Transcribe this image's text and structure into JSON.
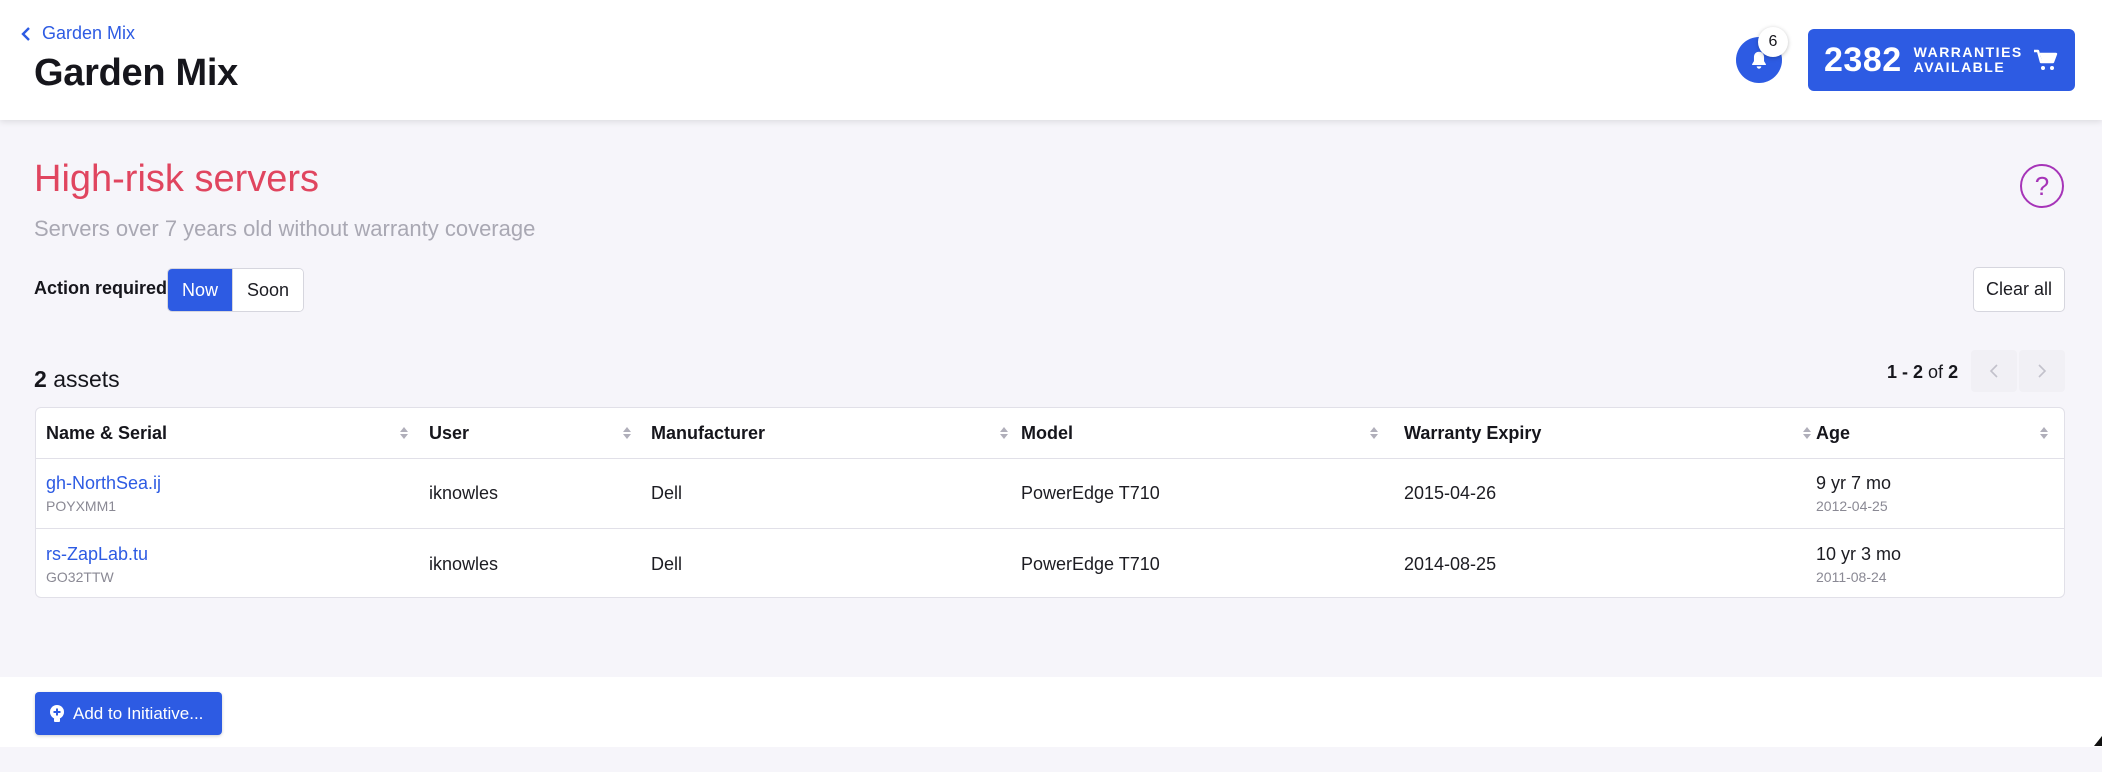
{
  "header": {
    "breadcrumb": "Garden Mix",
    "title": "Garden Mix",
    "notifications_count": "6",
    "warranties_count": "2382",
    "warranties_label_line1": "WARRANTIES",
    "warranties_label_line2": "AVAILABLE"
  },
  "section": {
    "title": "High-risk servers",
    "subtitle": "Servers over 7 years old without warranty coverage",
    "help_symbol": "?"
  },
  "filters": {
    "label": "Action required",
    "options": [
      "Now",
      "Soon"
    ],
    "selected": "Now",
    "clear_label": "Clear all"
  },
  "results": {
    "count": "2",
    "count_suffix": "assets",
    "range": "1 - 2",
    "of_label": "of",
    "total": "2"
  },
  "table": {
    "columns": [
      "Name & Serial",
      "User",
      "Manufacturer",
      "Model",
      "Warranty Expiry",
      "Age"
    ],
    "rows": [
      {
        "name": "gh-NorthSea.ij",
        "serial": "POYXMM1",
        "user": "iknowles",
        "manufacturer": "Dell",
        "model": "PowerEdge T710",
        "warranty_expiry": "2015-04-26",
        "age": "9 yr 7 mo",
        "age_date": "2012-04-25"
      },
      {
        "name": "rs-ZapLab.tu",
        "serial": "GO32TTW",
        "user": "iknowles",
        "manufacturer": "Dell",
        "model": "PowerEdge T710",
        "warranty_expiry": "2014-08-25",
        "age": "10 yr 3 mo",
        "age_date": "2011-08-24"
      }
    ]
  },
  "footer": {
    "add_button": "Add to Initiative..."
  },
  "colors": {
    "primary": "#2d5be3",
    "danger_title": "#e0455f",
    "help_accent": "#a634b8"
  },
  "icons": [
    "chevron-left-icon",
    "bell-icon",
    "cart-icon",
    "help-icon",
    "sort-icon",
    "chevron-right-icon",
    "lightbulb-plus-icon"
  ]
}
